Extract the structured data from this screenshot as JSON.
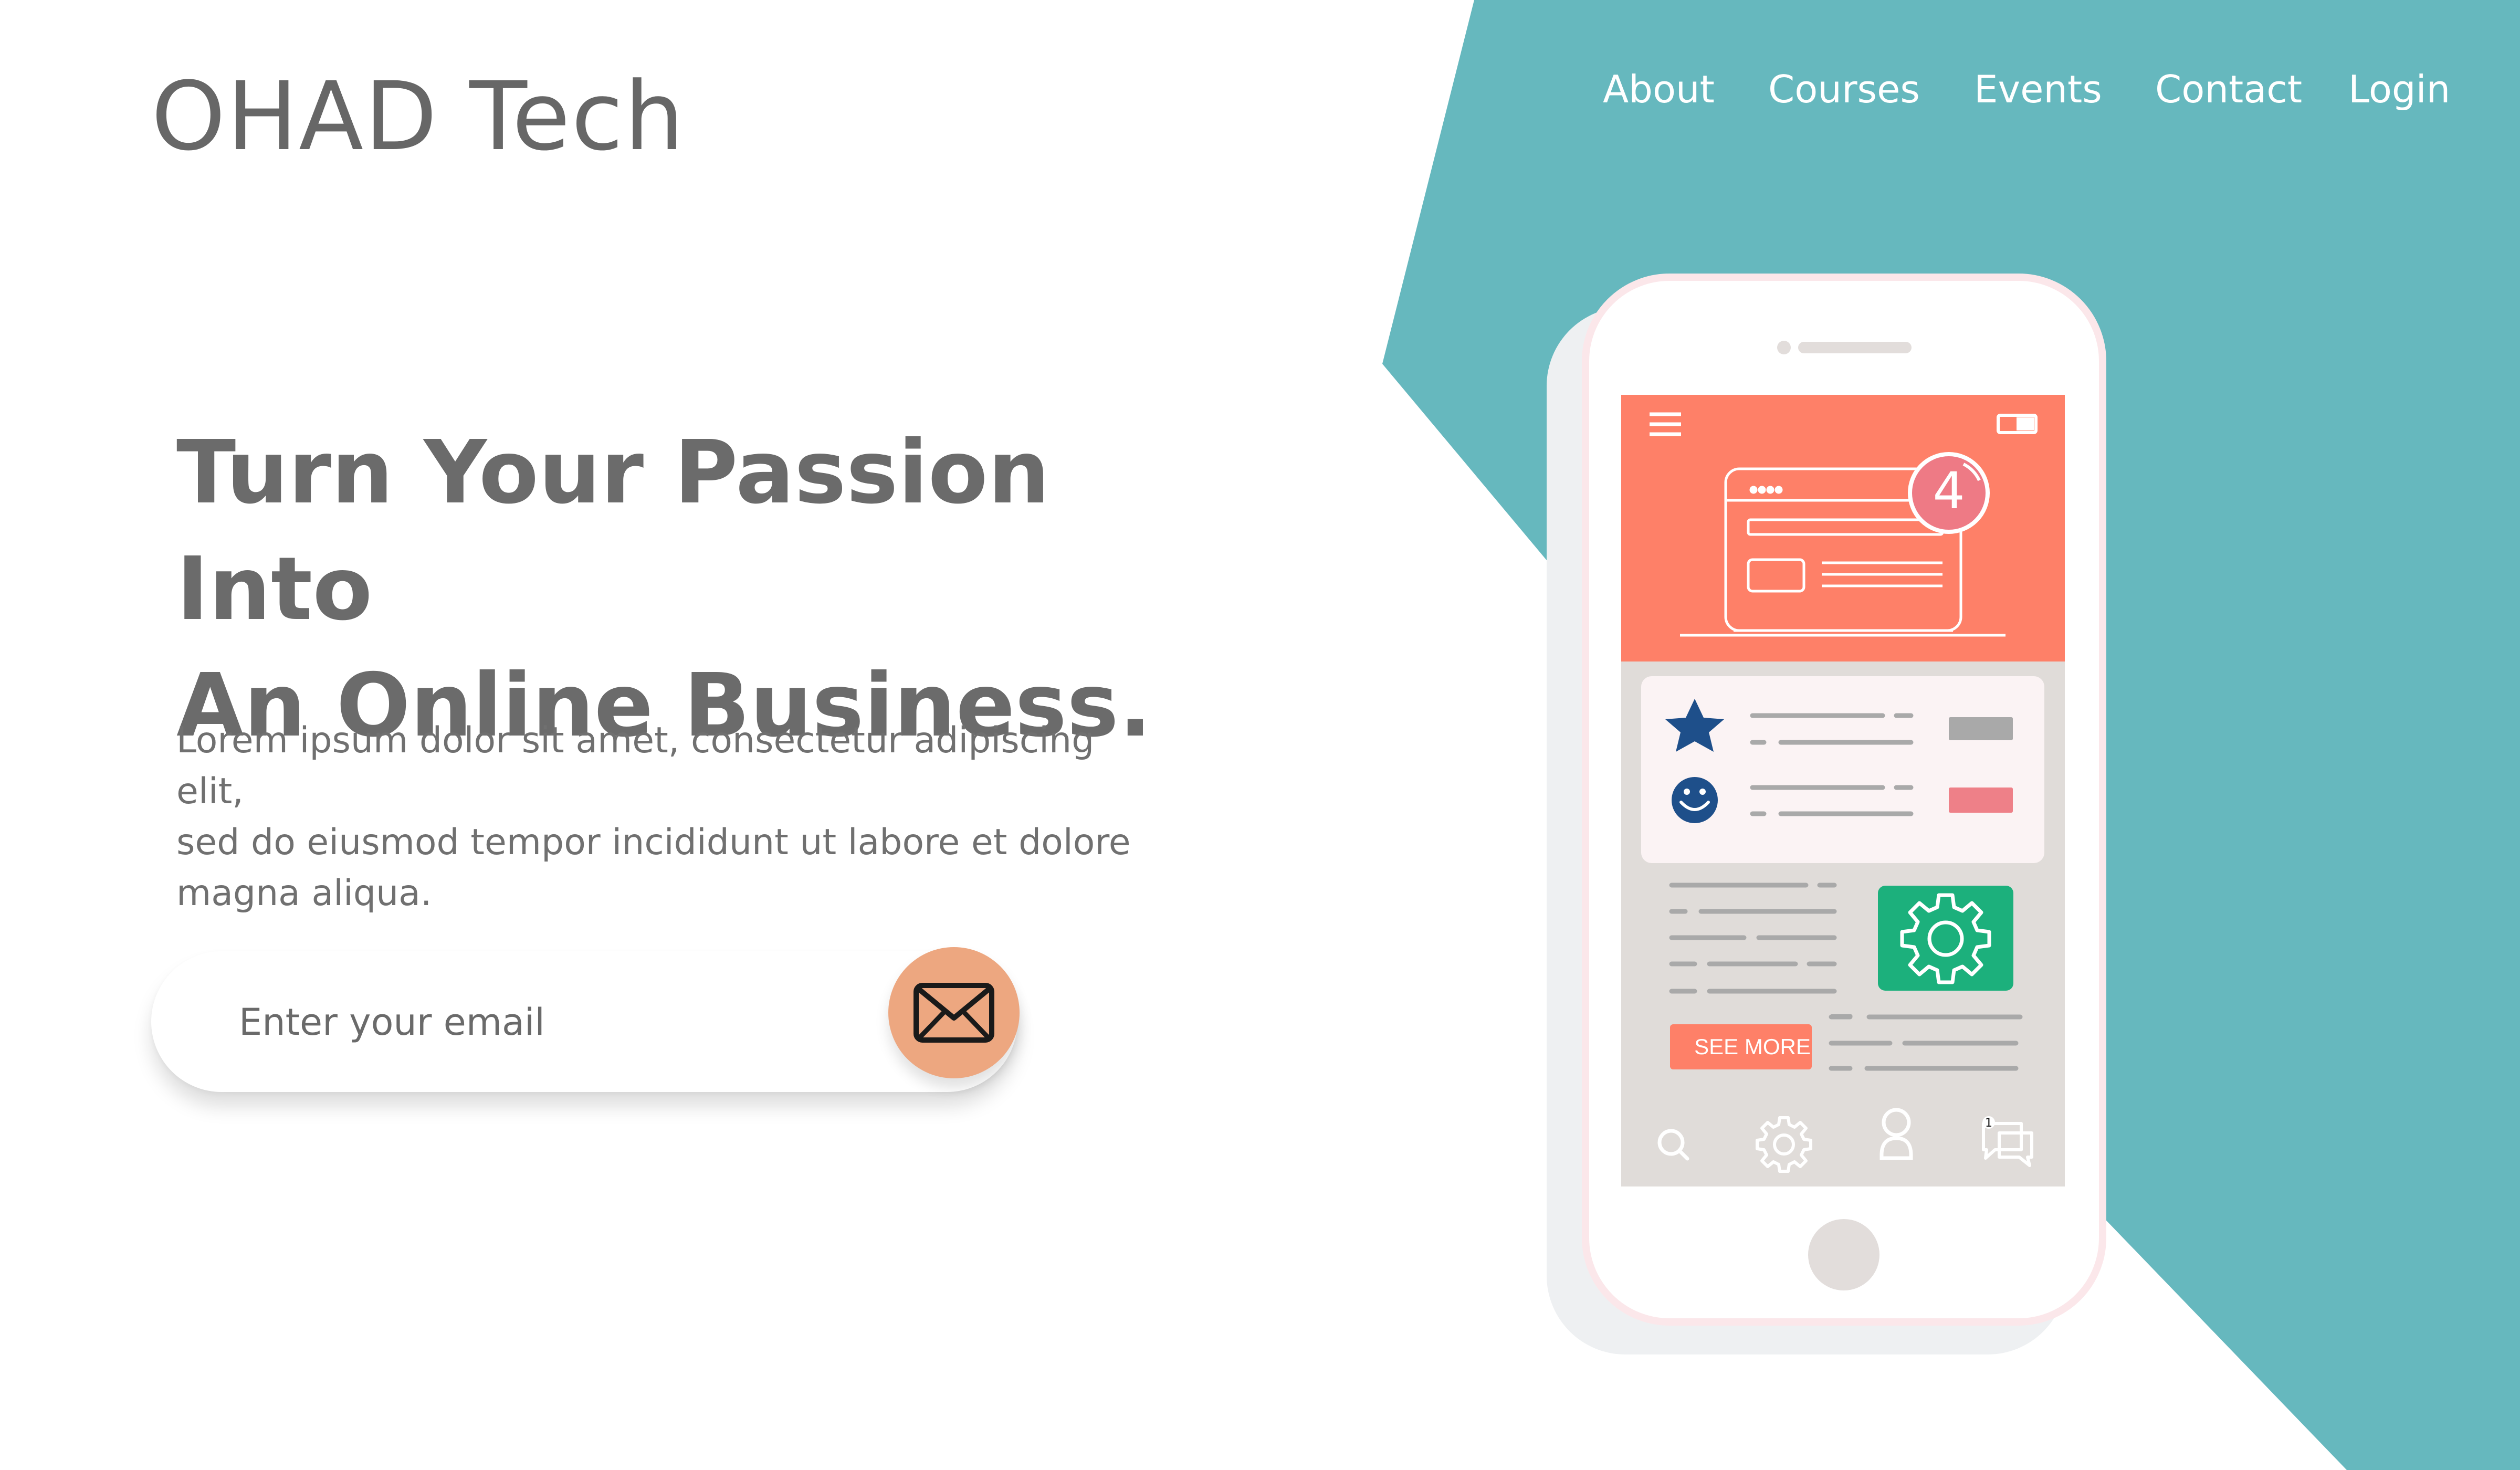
{
  "brand": {
    "name": "OHAD Tech"
  },
  "nav": {
    "items": [
      {
        "label": "About"
      },
      {
        "label": "Courses"
      },
      {
        "label": "Events"
      },
      {
        "label": "Contact"
      },
      {
        "label": "Login"
      }
    ]
  },
  "hero": {
    "headline_line1": "Turn Your Passion Into",
    "headline_line2": "An Online Business.",
    "body_line1": "Lorem ipsum dolor sit amet, consectetur adipiscing elit,",
    "body_line2": "sed do eiusmod tempor incididunt ut labore et dolore",
    "body_line3": "magna aliqua."
  },
  "signup": {
    "placeholder": "Enter your email",
    "button_icon": "envelope-icon"
  },
  "phone_mockup": {
    "notification_count": "4",
    "see_more_label": "SEE MORE",
    "chat_badge_count": "1",
    "icons": [
      "menu-icon",
      "battery-icon",
      "browser-window-icon",
      "star-icon",
      "smiley-icon",
      "gear-icon",
      "search-icon",
      "settings-icon",
      "user-icon",
      "chat-icon"
    ]
  },
  "colors": {
    "teal": "#66b8be",
    "coral": "#fe8068",
    "beige": "#e0dcd9",
    "green": "#1cb07c",
    "peach": "#eda780",
    "navy": "#1e4f8a",
    "text_gray": "#6b6b6b"
  }
}
